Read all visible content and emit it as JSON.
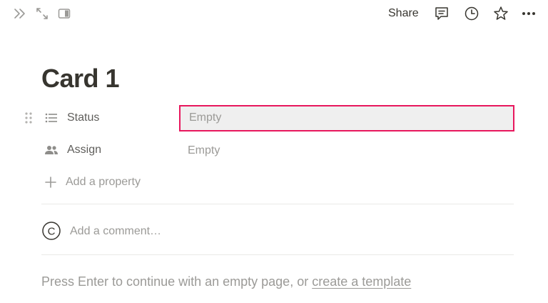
{
  "topbar": {
    "share_label": "Share",
    "icons": [
      "expand-icon",
      "fullscreen-icon",
      "side-peek-icon",
      "comments-icon",
      "history-icon",
      "star-icon",
      "more-icon"
    ]
  },
  "page": {
    "title": "Card 1"
  },
  "properties": [
    {
      "label": "Status",
      "value": "Empty",
      "icon": "list-icon"
    },
    {
      "label": "Assign",
      "value": "Empty",
      "icon": "people-icon"
    }
  ],
  "add_property_label": "Add a property",
  "comment": {
    "placeholder": "Add a comment…",
    "avatar_letter": "C"
  },
  "hint": {
    "text": "Press Enter to continue with an empty page, or",
    "link": "create a template"
  },
  "colors": {
    "highlight_border": "#e8175d",
    "text_primary": "#37352f",
    "text_muted": "#9b9a97"
  }
}
